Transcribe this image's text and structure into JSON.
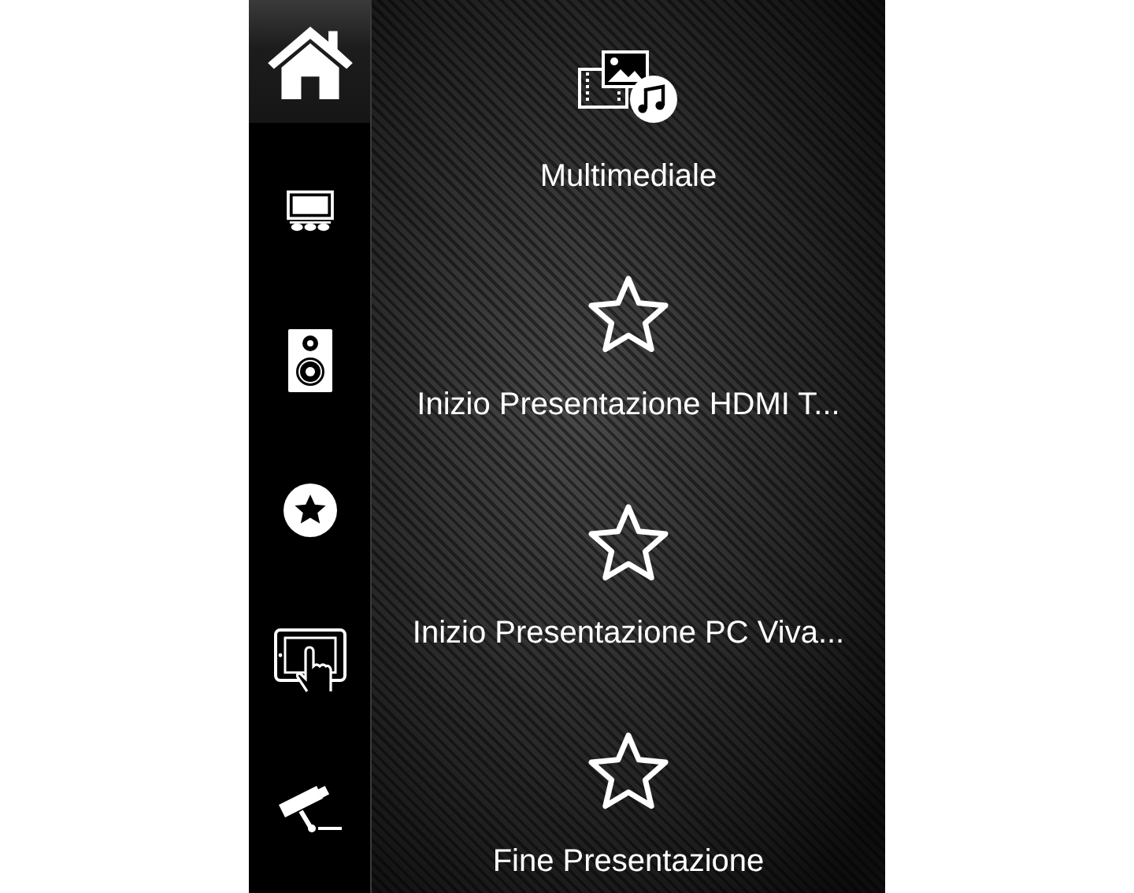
{
  "sidebar": {
    "items": [
      {
        "kind": "home",
        "selected": true
      },
      {
        "kind": "tv",
        "selected": false
      },
      {
        "kind": "speaker",
        "selected": false
      },
      {
        "kind": "favorites",
        "selected": false
      },
      {
        "kind": "touch",
        "selected": false
      },
      {
        "kind": "camera",
        "selected": false
      }
    ]
  },
  "scenes": [
    {
      "kind": "media",
      "label": "Multimediale"
    },
    {
      "kind": "favorite",
      "label": "Inizio Presentazione HDMI T..."
    },
    {
      "kind": "favorite",
      "label": "Inizio Presentazione PC Viva..."
    },
    {
      "kind": "favorite",
      "label": "Fine Presentazione"
    }
  ]
}
